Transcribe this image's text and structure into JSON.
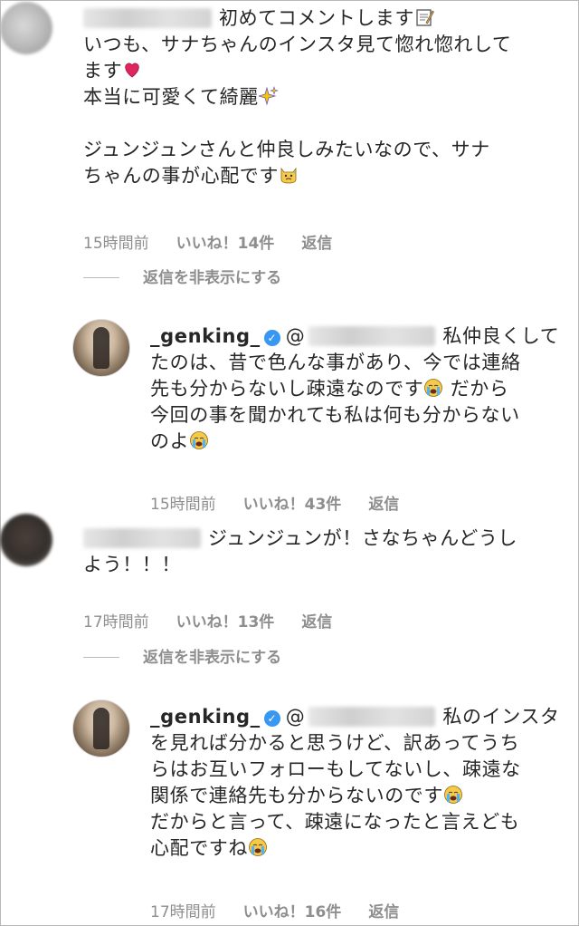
{
  "comments": [
    {
      "username_blurred": true,
      "lines": [
        "初めてコメントします",
        "いつも、サナちゃんのインスタ見て惚れ惚れして",
        "ます",
        "本当に可愛くて綺麗",
        "",
        "ジュンジュンさんと仲良しみたいなので、サナ",
        "ちゃんの事が心配です"
      ],
      "time": "15時間前",
      "likes": "いいね！14件",
      "reply_label": "返信",
      "hide_replies": "返信を非表示にする"
    },
    {
      "username": "_genking_",
      "verified": true,
      "lines": [
        "私仲良くして",
        "たのは、昔で色んな事があり、今では連絡",
        "先も分からないし疎遠なのです",
        "今回の事を聞かれても私は何も分からない",
        "のよ"
      ],
      "after_emoji": "だから",
      "time": "15時間前",
      "likes": "いいね！43件",
      "reply_label": "返信"
    },
    {
      "username_blurred": true,
      "lines": [
        "ジュンジュンが！さなちゃんどうし",
        "よう！！！"
      ],
      "time": "17時間前",
      "likes": "いいね！13件",
      "reply_label": "返信",
      "hide_replies": "返信を非表示にする"
    },
    {
      "username": "_genking_",
      "verified": true,
      "lines": [
        "私のインスタ",
        "を見れば分かると思うけど、訳あってうち",
        "らはお互いフォローもしてないし、疎遠な",
        "関係で連絡先も分からないのです",
        "だからと言って、疎遠になったと言えども",
        "心配ですね"
      ],
      "time": "17時間前",
      "likes": "いいね！16件",
      "reply_label": "返信"
    }
  ],
  "colors": {
    "text": "#262626",
    "meta": "#8e8e8e",
    "verified": "#3897f0"
  },
  "icons": [
    "memo-icon",
    "heart-icon",
    "sparkles-icon",
    "cat-sweat-icon",
    "crying-face-icon",
    "verified-badge-icon"
  ]
}
